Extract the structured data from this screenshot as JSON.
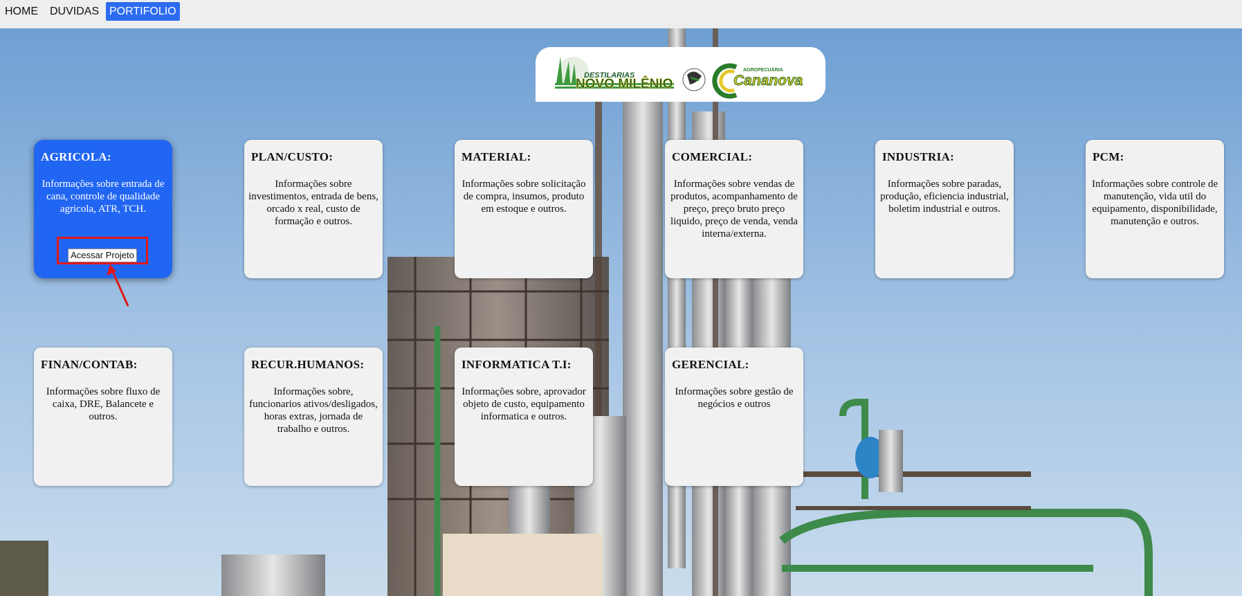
{
  "nav": {
    "items": [
      {
        "label": "HOME",
        "active": false
      },
      {
        "label": "DUVIDAS",
        "active": false
      },
      {
        "label": "PORTIFOLIO",
        "active": true
      }
    ]
  },
  "logos": {
    "left": {
      "line1": "DESTILARIAS",
      "line2": "NOVO MILÊNIO"
    },
    "right": {
      "line1": "AGROPECUÁRIA",
      "line2": "Cananova"
    }
  },
  "cards": [
    {
      "title": "AGRICOLA:",
      "desc": "Informações sobre entrada de cana, controle de qualidade agricola, ATR, TCH.",
      "button": "Acessar Projeto"
    },
    {
      "title": "PLAN/CUSTO:",
      "desc": "Informações sobre investimentos, entrada de bens, orcado x real, custo de formação e outros."
    },
    {
      "title": "MATERIAL:",
      "desc": "Informações sobre solicitação de compra, insumos, produto em estoque e outros."
    },
    {
      "title": "COMERCIAL:",
      "desc": "Informações sobre vendas de produtos, acompanhamento de preço, preço bruto preço liquido, preço de venda, venda interna/externa."
    },
    {
      "title": "INDUSTRIA:",
      "desc": "Informações sobre paradas, produção, eficiencia industrial, boletim industrial e outros."
    },
    {
      "title": "PCM:",
      "desc": "Informações sobre controle de manutenção, vida util do equipamento, disponibilidade, manutenção e outros."
    },
    {
      "title": "FINAN/CONTAB:",
      "desc": "Informações sobre fluxo de caixa, DRE, Balancete e outros."
    },
    {
      "title": "RECUR.HUMANOS:",
      "desc": "Informações sobre, funcionarios ativos/desligados, horas extras, jornada de trabalho e outros."
    },
    {
      "title": "INFORMATICA T.I:",
      "desc": "Informações sobre, aprovador objeto de custo, equipamento informatica e outros."
    },
    {
      "title": "GERENCIAL:",
      "desc": "Informações sobre gestão de negócios e outros"
    }
  ],
  "colors": {
    "accent": "#2166f3",
    "nav_active": "#2d6cf0",
    "card_bg": "#f1f1f1",
    "annotation": "#e01818"
  }
}
